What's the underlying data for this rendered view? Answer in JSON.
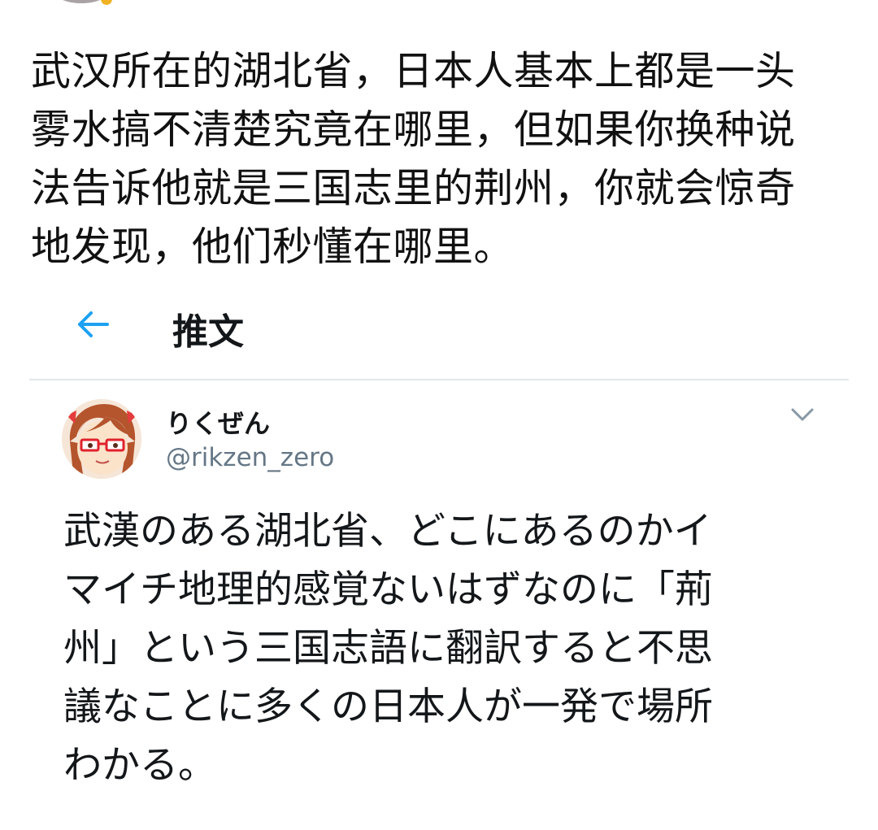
{
  "caption": {
    "text": "武汉所在的湖北省，日本人基本上都是一头\n雾水搞不清楚究竟在哪里，但如果你换种说\n法告诉他就是三国志里的荆州，你就会惊奇\n地发现，他们秒懂在哪里。"
  },
  "header": {
    "back_icon": "arrow-left-icon",
    "title": "推文",
    "accent_color": "#1da1f2"
  },
  "tweet": {
    "author": {
      "display_name": "りくぜん",
      "handle": "@rikzen_zero",
      "avatar_icon": "avatar-anime-girl-glasses"
    },
    "more_icon": "chevron-down-icon",
    "text": "武漢のある湖北省、どこにあるのかイ\nマイチ地理的感覚ないはずなのに「荊\n州」という三国志語に翻訳すると不思\n議なことに多くの日本人が一発で場所\nわかる。"
  }
}
